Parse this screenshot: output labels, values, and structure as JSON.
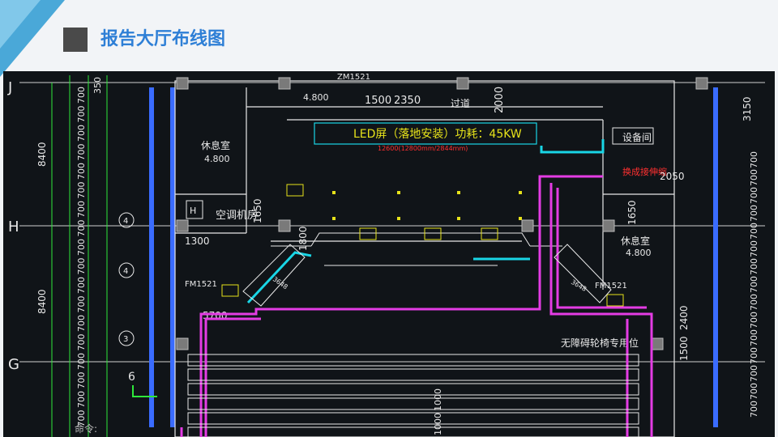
{
  "slide": {
    "title": "报告大厅布线图"
  },
  "drawing": {
    "grid_labels": {
      "j": "J",
      "h": "H",
      "g": "G"
    },
    "left_dims": {
      "top_span": "8400",
      "bottom_span": "8400",
      "small": "6"
    },
    "left_column_700": "700",
    "left_column_350": "350",
    "top_labels": {
      "door_top": "ZM1521",
      "dim_4800_top": "4.800",
      "dim_1500": "1500",
      "dim_2350": "2350",
      "corridor": "过道",
      "dim_2000": "2000"
    },
    "led_banner": "LED屏（落地安装）功耗：45KW",
    "led_sub": "12600(12800mm/2844mm)",
    "rooms": {
      "rest_left": "休息室",
      "rest_left_level": "4.800",
      "ac_room": "空调机房",
      "equipment": "设备间",
      "switch": "换成接伸缩",
      "rest_right": "休息室",
      "rest_right_level": "4.800",
      "accessible": "无障碍轮椅专用位"
    },
    "dims": {
      "d1650a": "1650",
      "d1300": "1300",
      "d1800": "1800",
      "d1650b": "1650",
      "d2050": "2050",
      "d5700": "5700",
      "d2400": "2400",
      "d1500": "1500",
      "d3150": "3150",
      "d1000a": "1000",
      "d1000b": "1000",
      "d3648a": "3648",
      "d3648b": "3648"
    },
    "doors": {
      "fm_left": "FM1521",
      "fm_right": "FM1521",
      "door_h": "H"
    },
    "axis_markers": [
      "4",
      "4",
      "3"
    ],
    "right_column_700": "700",
    "watermark": "命令:"
  },
  "colors": {
    "title_blue": "#2e7fd6",
    "cad_bg": "#101418",
    "green": "#2ee83a",
    "magenta": "#e43ce4",
    "cyan": "#19d6e6",
    "yellow": "#e6e21a",
    "white": "#e8e8e8",
    "blue": "#3a6cff",
    "red": "#ff3030",
    "accent_tri": "#4aa8d8"
  }
}
